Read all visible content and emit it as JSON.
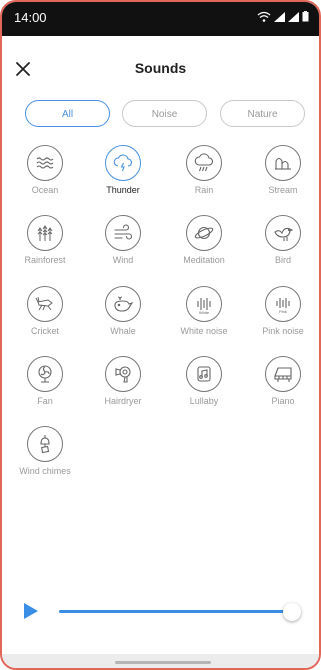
{
  "status": {
    "time": "14:00"
  },
  "header": {
    "title": "Sounds"
  },
  "tabs": [
    {
      "label": "All",
      "active": true
    },
    {
      "label": "Noise",
      "active": false
    },
    {
      "label": "Nature",
      "active": false
    }
  ],
  "sounds": [
    {
      "label": "Ocean",
      "icon": "waves-icon"
    },
    {
      "label": "Thunder",
      "icon": "thunder-cloud-icon",
      "active": true
    },
    {
      "label": "Rain",
      "icon": "rain-cloud-icon"
    },
    {
      "label": "Stream",
      "icon": "stream-icon"
    },
    {
      "label": "Rainforest",
      "icon": "trees-icon"
    },
    {
      "label": "Wind",
      "icon": "wind-icon"
    },
    {
      "label": "Meditation",
      "icon": "planet-icon"
    },
    {
      "label": "Bird",
      "icon": "bird-icon"
    },
    {
      "label": "Cricket",
      "icon": "cricket-icon"
    },
    {
      "label": "Whale",
      "icon": "whale-icon"
    },
    {
      "label": "White noise",
      "icon": "white-noise-icon",
      "badge": "White"
    },
    {
      "label": "Pink noise",
      "icon": "pink-noise-icon",
      "badge": "Pink"
    },
    {
      "label": "Fan",
      "icon": "fan-icon"
    },
    {
      "label": "Hairdryer",
      "icon": "hairdryer-icon"
    },
    {
      "label": "Lullaby",
      "icon": "music-note-icon"
    },
    {
      "label": "Piano",
      "icon": "piano-icon"
    },
    {
      "label": "Wind chimes",
      "icon": "wind-chimes-icon"
    }
  ],
  "player": {
    "volume": 0.98
  },
  "colors": {
    "accent": "#3a8ee6",
    "frame": "#e2675b"
  }
}
